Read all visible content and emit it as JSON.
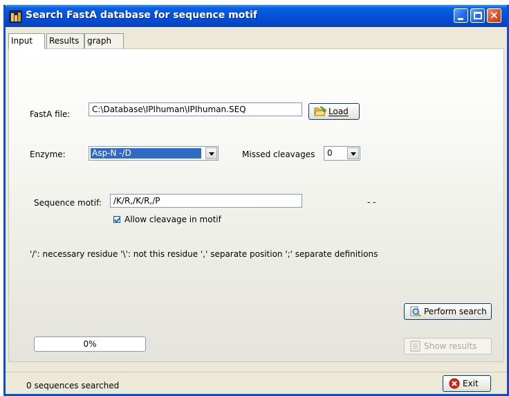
{
  "window": {
    "title": "Search FastA database for sequence motif",
    "controls": {
      "minimize": "minimize",
      "maximize": "maximize",
      "close": "×"
    }
  },
  "tabs": [
    {
      "label": "Input",
      "active": true
    },
    {
      "label": "Results",
      "active": false
    },
    {
      "label": "graph",
      "active": false
    }
  ],
  "form": {
    "fasta_label": "FastA file:",
    "fasta_value": "C:\\Database\\IPIhuman\\IPIhuman.SEQ",
    "load_button": "Load",
    "enzyme_label": "Enzyme:",
    "enzyme_value": "Asp-N          -/D",
    "missed_label": "Missed cleavages",
    "missed_value": "0",
    "motif_label": "Sequence motif:",
    "motif_value": "/K/R,/K/R,/P",
    "motif_status": "- -",
    "allow_cleavage_label": "Allow cleavage in motif",
    "allow_cleavage_checked": true,
    "help_text": "'/': necessary residue '\\': not this residue ',' separate position ';' separate definitions"
  },
  "actions": {
    "perform_search": "Perform search",
    "show_results": "Show results",
    "show_results_enabled": false,
    "exit": "Exit"
  },
  "progress": {
    "percent_text": "0%",
    "value": 0
  },
  "status": {
    "text": "0 sequences searched"
  },
  "colors": {
    "titlebar": "#0450d8",
    "selection": "#316ac5",
    "accent_exit": "#d2281e"
  }
}
